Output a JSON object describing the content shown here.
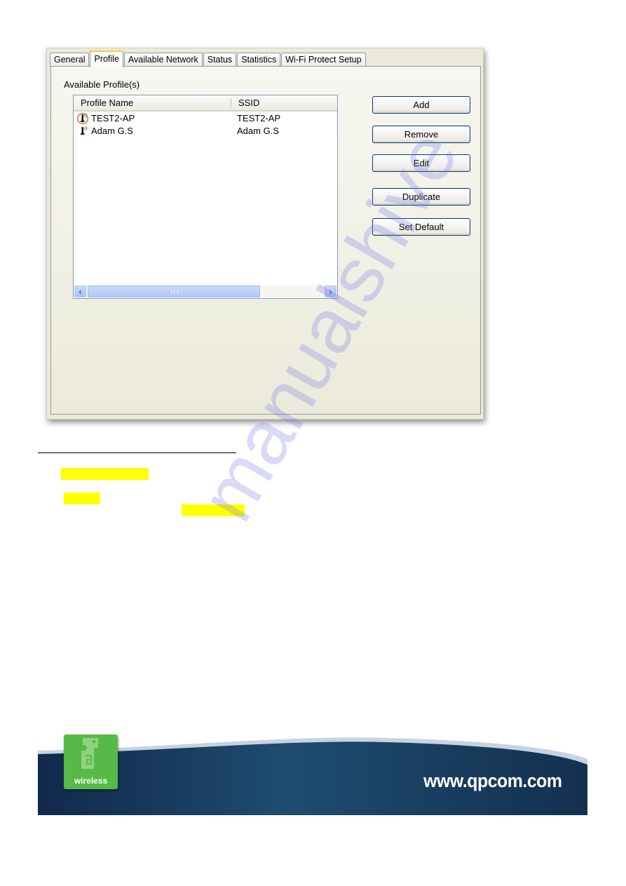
{
  "tabs": [
    {
      "label": "General",
      "active": false
    },
    {
      "label": "Profile",
      "active": true
    },
    {
      "label": "Available Network",
      "active": false
    },
    {
      "label": "Status",
      "active": false
    },
    {
      "label": "Statistics",
      "active": false
    },
    {
      "label": "Wi-Fi Protect Setup",
      "active": false
    }
  ],
  "profile_panel": {
    "group_label": "Available Profile(s)",
    "columns": [
      "Profile Name",
      "SSID"
    ],
    "rows": [
      {
        "icon": "connected-ap-signal-icon",
        "profile_name": "TEST2-AP",
        "ssid": "TEST2-AP"
      },
      {
        "icon": "ap-signal-icon",
        "profile_name": "Adam G.S",
        "ssid": "Adam G.S"
      }
    ],
    "buttons": {
      "add": "Add",
      "remove": "Remove",
      "edit": "Edit",
      "duplicate": "Duplicate",
      "set_default": "Set Default"
    }
  },
  "watermark": "manualshive",
  "footer": {
    "logo_text": "wireless",
    "website": "www.qpcom.com"
  }
}
